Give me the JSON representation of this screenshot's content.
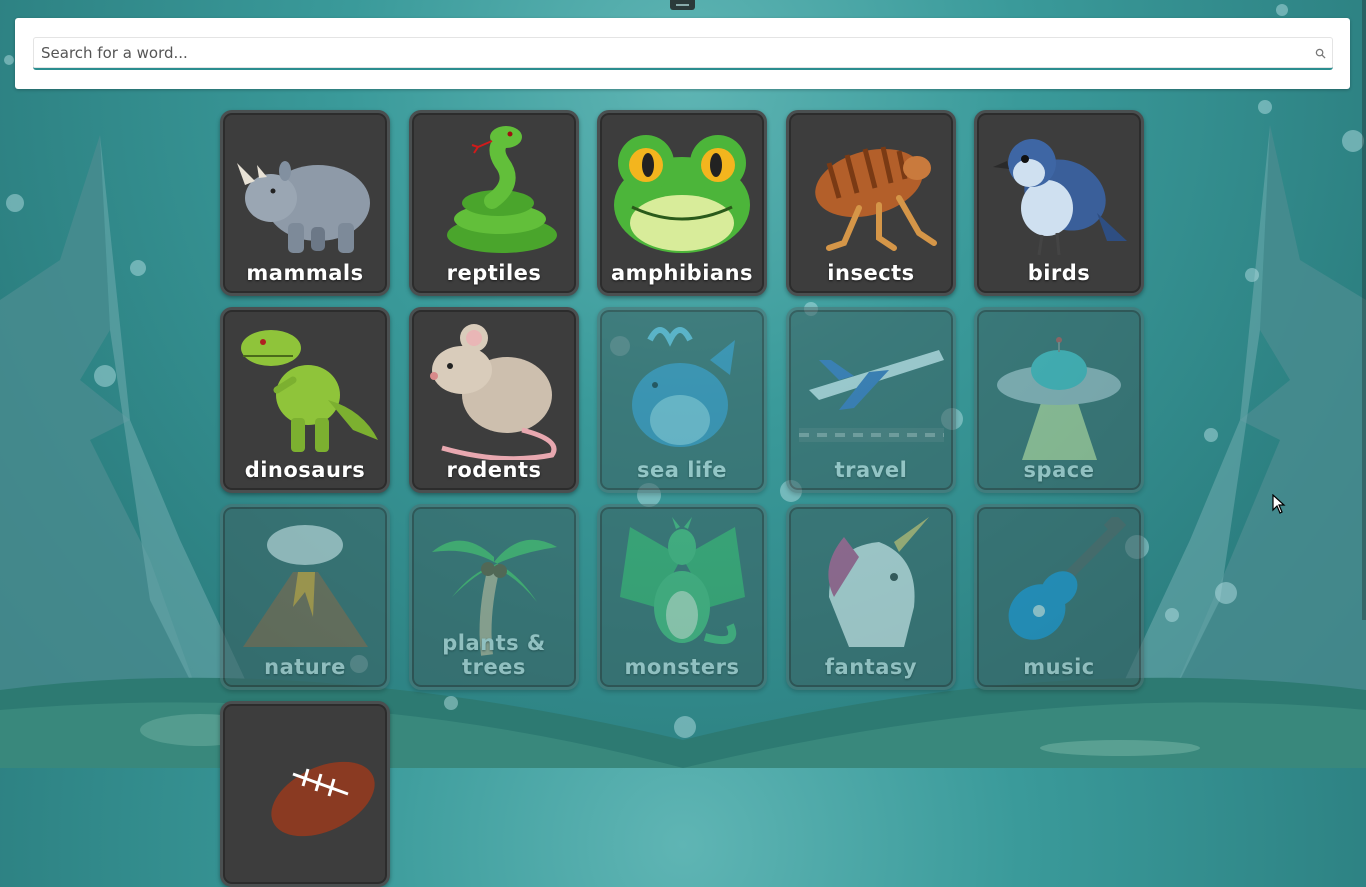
{
  "search": {
    "placeholder": "Search for a word..."
  },
  "categories": [
    {
      "label": "mammals"
    },
    {
      "label": "reptiles"
    },
    {
      "label": "amphibians"
    },
    {
      "label": "insects"
    },
    {
      "label": "birds"
    },
    {
      "label": "dinosaurs"
    },
    {
      "label": "rodents"
    },
    {
      "label": "sea life"
    },
    {
      "label": "travel"
    },
    {
      "label": "space"
    },
    {
      "label": "nature"
    },
    {
      "label": "plants & trees"
    },
    {
      "label": "monsters"
    },
    {
      "label": "fantasy"
    },
    {
      "label": "music"
    },
    {
      "label": ""
    }
  ],
  "colors": {
    "accent": "#2a8d8f",
    "tile": "#3d3d3d",
    "background": "#3a9a9a"
  }
}
